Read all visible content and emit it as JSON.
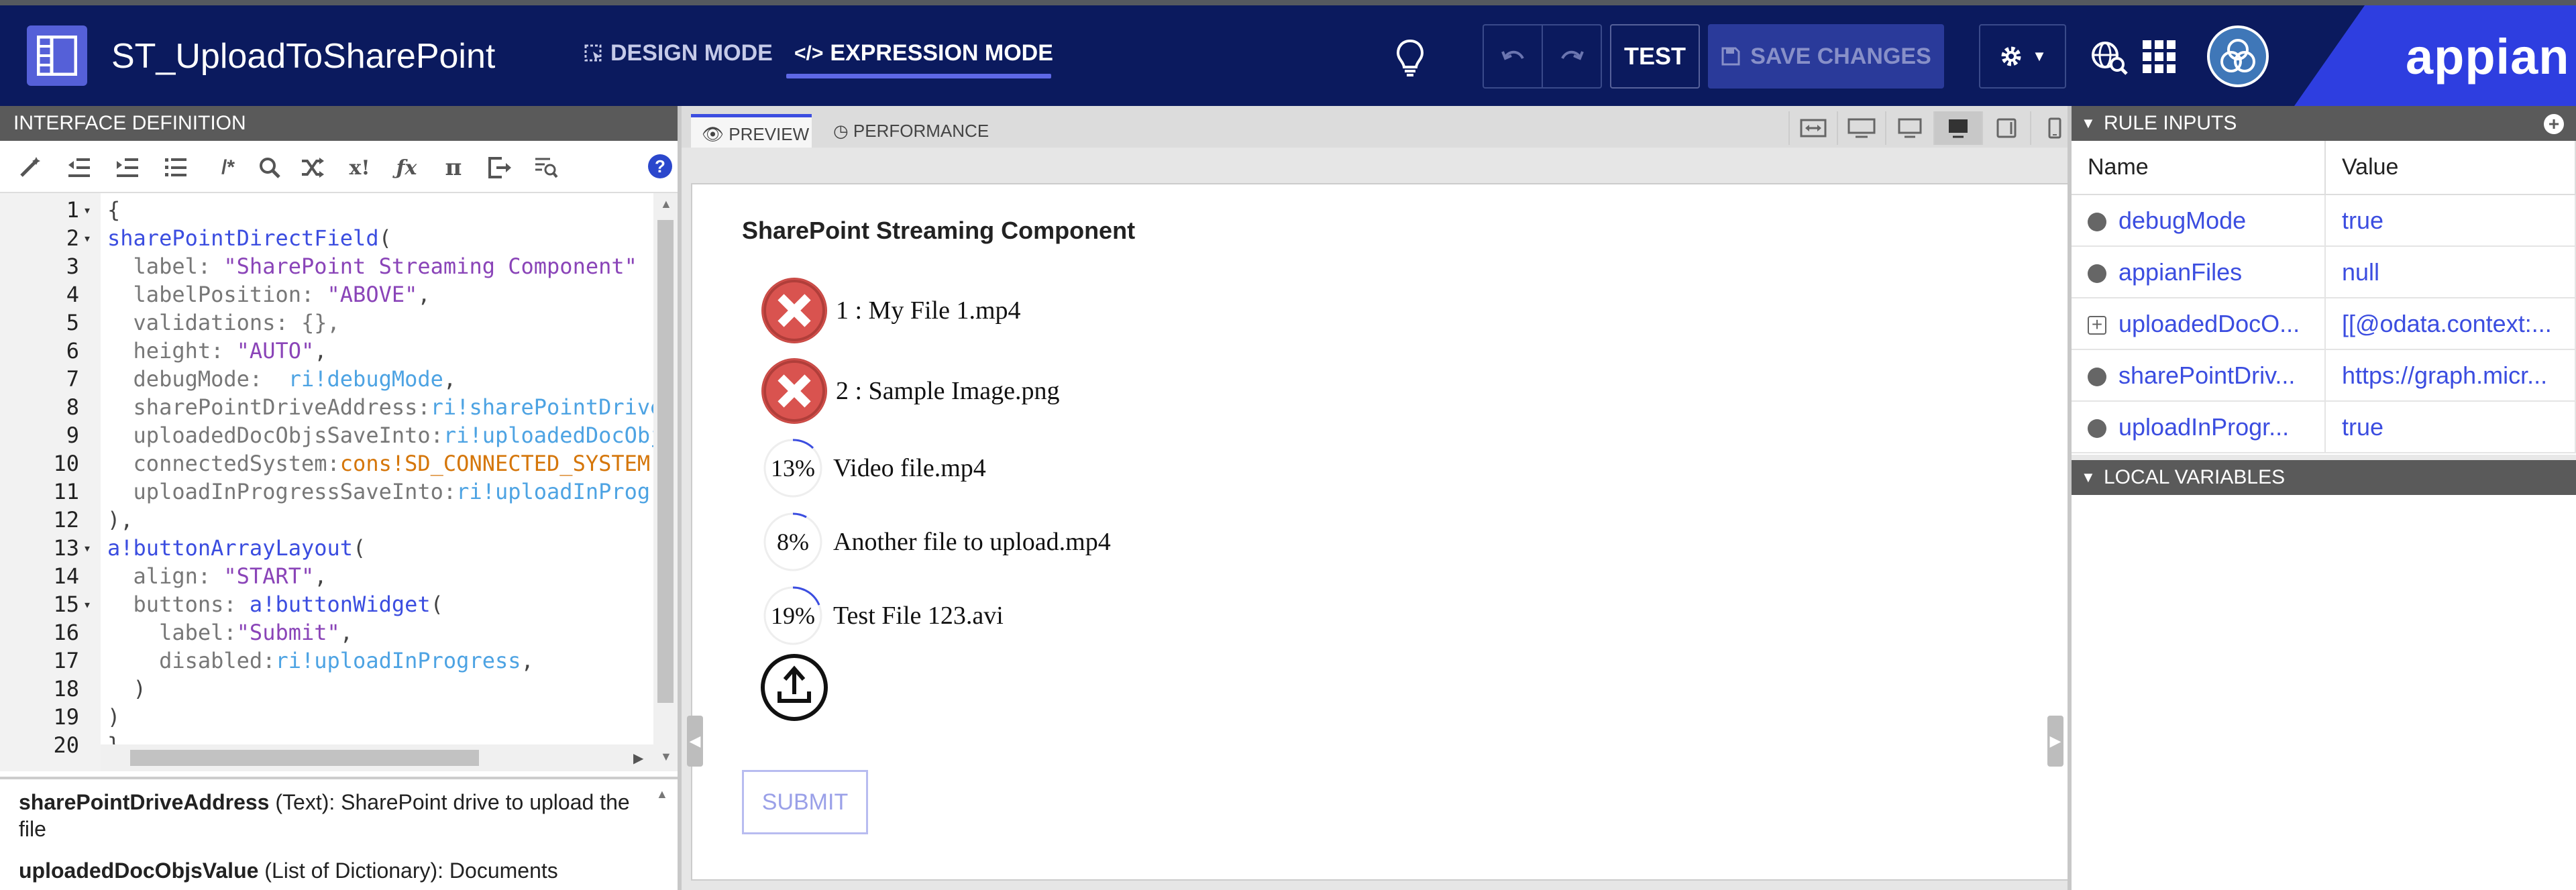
{
  "header": {
    "title": "ST_UploadToSharePoint",
    "design_mode": "DESIGN MODE",
    "expression_mode": "EXPRESSION MODE",
    "test": "TEST",
    "save": "SAVE CHANGES",
    "brand": "appian"
  },
  "left": {
    "title": "INTERFACE DEFINITION",
    "help": "?",
    "lines": [
      {
        "n": "1",
        "fold": "▾"
      },
      {
        "n": "2",
        "fold": "▾"
      },
      {
        "n": "3",
        "fold": ""
      },
      {
        "n": "4",
        "fold": ""
      },
      {
        "n": "5",
        "fold": ""
      },
      {
        "n": "6",
        "fold": ""
      },
      {
        "n": "7",
        "fold": ""
      },
      {
        "n": "8",
        "fold": ""
      },
      {
        "n": "9",
        "fold": ""
      },
      {
        "n": "10",
        "fold": ""
      },
      {
        "n": "11",
        "fold": ""
      },
      {
        "n": "12",
        "fold": ""
      },
      {
        "n": "13",
        "fold": "▾"
      },
      {
        "n": "14",
        "fold": ""
      },
      {
        "n": "15",
        "fold": "▾"
      },
      {
        "n": "16",
        "fold": ""
      },
      {
        "n": "17",
        "fold": ""
      },
      {
        "n": "18",
        "fold": ""
      },
      {
        "n": "19",
        "fold": ""
      },
      {
        "n": "20",
        "fold": ""
      }
    ],
    "code": {
      "l1": "{",
      "l2_fn": "sharePointDirectField",
      "l2_p": "(",
      "l3_k": "  label: ",
      "l3_v": "\"SharePoint Streaming Component\"",
      "l4_k": "  labelPosition: ",
      "l4_v": "\"ABOVE\"",
      "l4_e": ",",
      "l5": "  validations: {},",
      "l6_k": "  height: ",
      "l6_v": "\"AUTO\"",
      "l6_e": ",",
      "l7_k": "  debugMode:  ",
      "l7_v": "ri!debugMode",
      "l7_e": ",",
      "l8_k": "  sharePointDriveAddress:",
      "l8_v": "ri!sharePointDriveAddress",
      "l9_k": "  uploadedDocObjsSaveInto:",
      "l9_v": "ri!uploadedDocObjsValue",
      "l10_k": "  connectedSystem:",
      "l10_v": "cons!SD_CONNECTED_SYSTEM",
      "l11_k": "  uploadInProgressSaveInto:",
      "l11_v": "ri!uploadInProgress",
      "l12": "),",
      "l13_fn": "a!buttonArrayLayout",
      "l13_p": "(",
      "l14_k": "  align: ",
      "l14_v": "\"START\"",
      "l14_e": ",",
      "l15_k": "  buttons: ",
      "l15_fn": "a!buttonWidget",
      "l15_p": "(",
      "l16_k": "    label:",
      "l16_v": "\"Submit\"",
      "l16_e": ",",
      "l17_k": "    disabled:",
      "l17_v": "ri!uploadInProgress",
      "l17_e": ",",
      "l18": "  )",
      "l19": ")",
      "l20": "}"
    },
    "docs": {
      "d1_name": "sharePointDriveAddress",
      "d1_desc": " (Text): SharePoint drive to upload the file",
      "d2_name": "uploadedDocObjsValue",
      "d2_desc": " (List of Dictionary): Documents"
    }
  },
  "center": {
    "tab_preview": "PREVIEW",
    "tab_performance": "PERFORMANCE",
    "component_title": "SharePoint Streaming Component",
    "files": [
      {
        "name": "1 : My File 1.mp4",
        "status": "error"
      },
      {
        "name": "2 : Sample Image.png",
        "status": "error"
      },
      {
        "name": "Video file.mp4",
        "progress": "13%"
      },
      {
        "name": "Another file to upload.mp4",
        "progress": "8%"
      },
      {
        "name": "Test File 123.avi",
        "progress": "19%"
      }
    ],
    "submit": "SUBMIT"
  },
  "right": {
    "rule_inputs_title": "RULE INPUTS",
    "col_name": "Name",
    "col_value": "Value",
    "rows": [
      {
        "name": "debugMode",
        "value": "true"
      },
      {
        "name": "appianFiles",
        "value": "null"
      },
      {
        "name": "uploadedDocO...",
        "value": "[[@odata.context:..."
      },
      {
        "name": "sharePointDriv...",
        "value": "https://graph.micr..."
      },
      {
        "name": "uploadInProgr...",
        "value": "true"
      }
    ],
    "local_vars_title": "LOCAL VARIABLES"
  },
  "colors": {
    "header_bg": "#0b1a5e",
    "accent": "#3b4de0",
    "error_red": "#d9534f"
  }
}
